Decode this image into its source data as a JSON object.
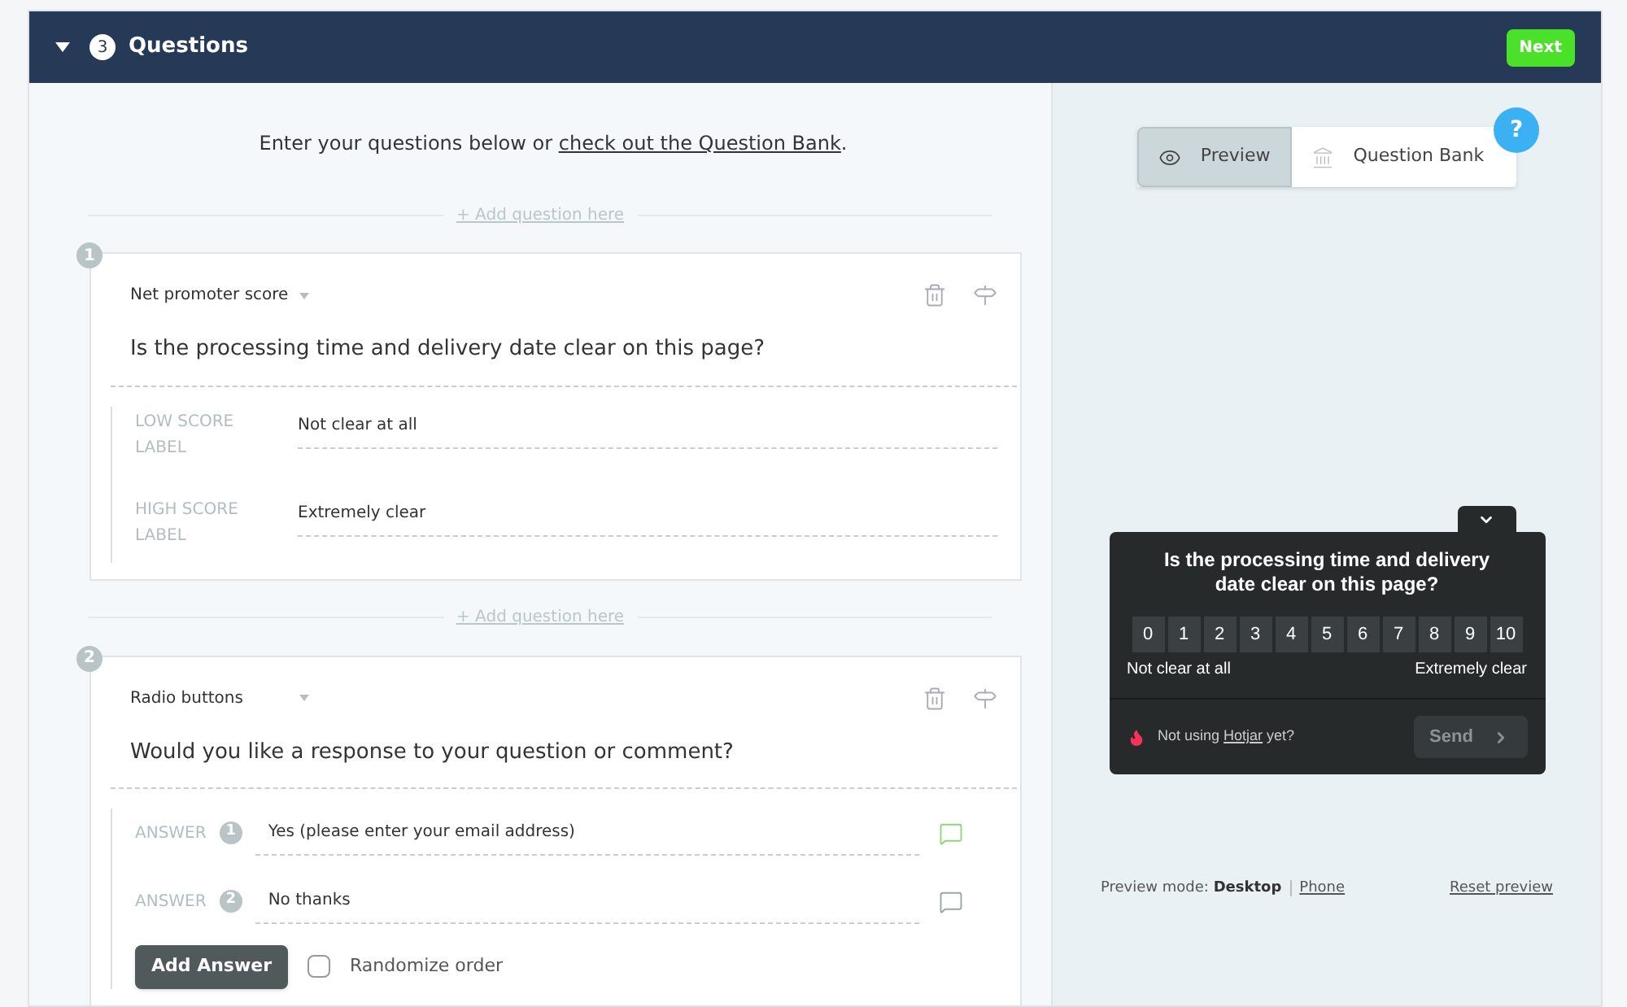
{
  "section": {
    "expanded": true,
    "number": "3",
    "title": "Questions",
    "next_button": "Next"
  },
  "intro": {
    "text": "Enter your questions below or ",
    "link": "check out the Question Bank",
    "end": "."
  },
  "questions": [
    {
      "kind": "nps",
      "add_link": "+ Add question here",
      "number": "1",
      "type": "Net promoter score",
      "text": "Is the processing time and delivery date clear on this page?",
      "labels": [
        {
          "label": "LOW SCORE LABEL",
          "value": "Not clear at all"
        },
        {
          "label": "HIGH SCORE LABEL",
          "value": "Extremely clear"
        }
      ]
    },
    {
      "kind": "radio",
      "add_link": "+ Add question here",
      "number": "2",
      "type": "Radio buttons",
      "text": "Would you like a response to your question or comment?",
      "answers": [
        {
          "label": "ANSWER",
          "number": "1",
          "value": "Yes (please enter your email address)",
          "comment_enabled": true
        },
        {
          "label": "ANSWER",
          "number": "2",
          "value": "No thanks",
          "comment_enabled": false
        }
      ],
      "add_answer": "Add Answer",
      "randomize": {
        "label": "Randomize order",
        "checked": false
      }
    }
  ],
  "preview": {
    "tabs": [
      {
        "kind": "preview",
        "label": "Preview",
        "selected": true
      },
      {
        "kind": "bank",
        "label": "Question Bank",
        "selected": false
      }
    ],
    "help": "?",
    "widget": {
      "question": "Is the processing time and delivery date clear on this page?",
      "scale": [
        "0",
        "1",
        "2",
        "3",
        "4",
        "5",
        "6",
        "7",
        "8",
        "9",
        "10"
      ],
      "low_label": "Not clear at all",
      "high_label": "Extremely clear",
      "footer": {
        "before": "Not using ",
        "link": "Hotjar",
        "after": " yet?"
      },
      "send": {
        "label": "Send",
        "disabled": true
      }
    },
    "mode": {
      "label": "Preview mode: ",
      "options": [
        {
          "label": "Desktop",
          "selected": true
        },
        {
          "label": "Phone",
          "selected": false
        }
      ]
    },
    "reset": "Reset preview"
  }
}
